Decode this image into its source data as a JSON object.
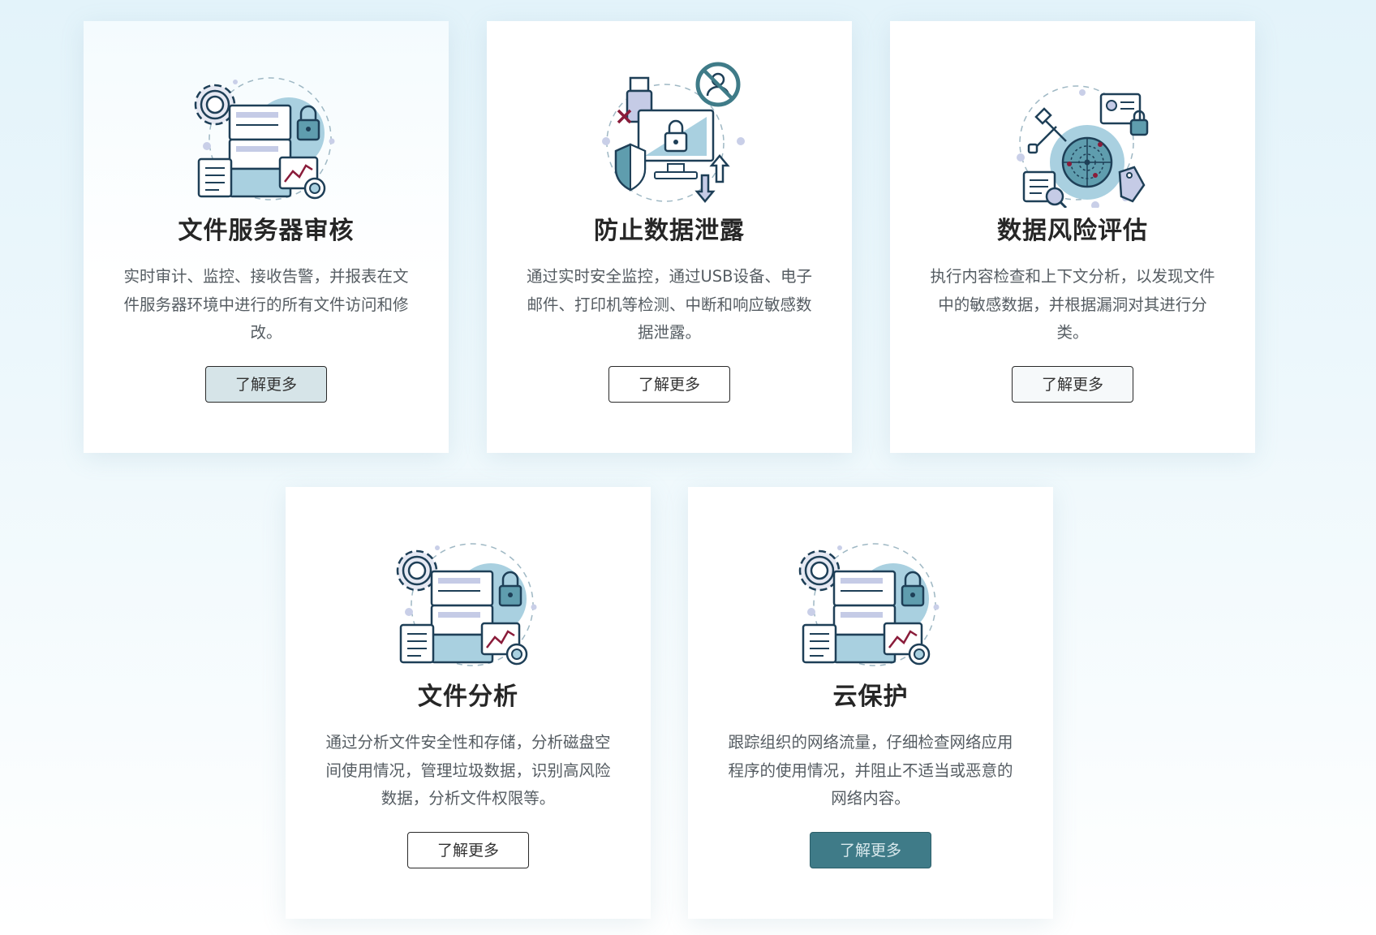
{
  "cards": [
    {
      "title": "文件服务器审核",
      "description": "实时审计、监控、接收告警，并报表在文件服务器环境中进行的所有文件访问和修改。",
      "button": "了解更多",
      "icon": "file-server-audit-illustration"
    },
    {
      "title": "防止数据泄露",
      "description": "通过实时安全监控，通过USB设备、电子邮件、打印机等检测、中断和响应敏感数据泄露。",
      "button": "了解更多",
      "icon": "data-leak-prevention-illustration"
    },
    {
      "title": "数据风险评估",
      "description": "执行内容检查和上下文分析，以发现文件中的敏感数据，并根据漏洞对其进行分类。",
      "button": "了解更多",
      "icon": "data-risk-assessment-illustration"
    },
    {
      "title": "文件分析",
      "description": "通过分析文件安全性和存储，分析磁盘空间使用情况，管理垃圾数据，识别高风险数据，分析文件权限等。",
      "button": "了解更多",
      "icon": "file-analysis-illustration"
    },
    {
      "title": "云保护",
      "description": "跟踪组织的网络流量，仔细检查网络应用程序的使用情况，并阻止不适当或恶意的网络内容。",
      "button": "了解更多",
      "icon": "cloud-protection-illustration"
    }
  ],
  "colors": {
    "accent": "#3f7b88",
    "outline": "#1e3f57",
    "fill_light": "#a9d0e0",
    "alert": "#8a1c3a"
  }
}
